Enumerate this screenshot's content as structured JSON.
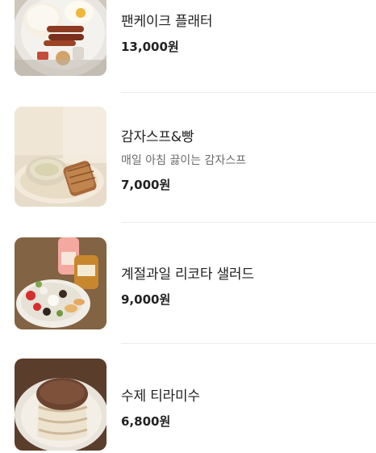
{
  "menu": {
    "items": [
      {
        "name": "팬케이크 플래터",
        "price": "13,000원",
        "photo": "pancake-platter-photo"
      },
      {
        "name": "감자스프&빵",
        "description": "매일 아침 끓이는 감자스프",
        "price": "7,000원",
        "photo": "potato-soup-bread-photo"
      },
      {
        "name": "계절과일 리코타 샐러드",
        "price": "9,000원",
        "photo": "ricotta-salad-photo"
      },
      {
        "name": "수제 티라미수",
        "price": "6,800원",
        "photo": "tiramisu-photo"
      }
    ]
  }
}
